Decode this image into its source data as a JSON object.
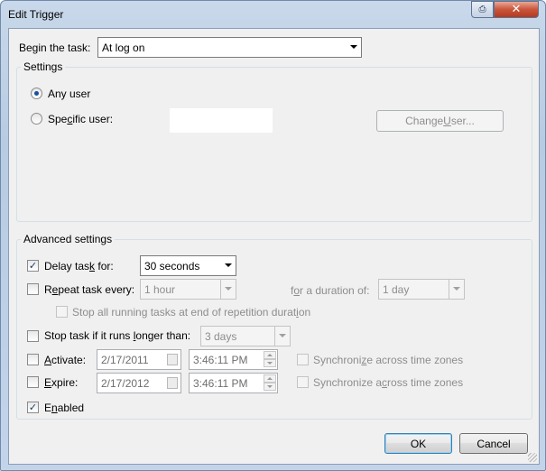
{
  "window": {
    "title": "Edit Trigger",
    "help_icon": "help-icon",
    "close_glyph": "✕"
  },
  "begin_task": {
    "label_prefix": "Begin the task:",
    "value": "At log on"
  },
  "settings": {
    "title": "Settings",
    "any_user": "Any user",
    "specific_user_pre": "Spe",
    "specific_user_u": "c",
    "specific_user_post": "ific user:",
    "change_user_pre": "Change ",
    "change_user_u": "U",
    "change_user_post": "ser..."
  },
  "advanced": {
    "title": "Advanced settings",
    "delay": {
      "checked": true,
      "label_pre": "Delay tas",
      "label_u": "k",
      "label_post": " for:",
      "value": "30 seconds"
    },
    "repeat": {
      "checked": false,
      "label_pre": "R",
      "label_u": "e",
      "label_post": "peat task every:",
      "value": "1 hour",
      "duration_pre": "f",
      "duration_u": "o",
      "duration_post": "r a duration of:",
      "duration_value": "1 day"
    },
    "stop_all": {
      "checked": false,
      "label_pre": "Stop all running tasks at end of repetition durat",
      "label_u": "i",
      "label_post": "on"
    },
    "stop_longer": {
      "checked": false,
      "label_pre": "Stop task if it runs ",
      "label_u": "l",
      "label_post": "onger than:",
      "value": "3 days"
    },
    "activate": {
      "checked": false,
      "label_u": "A",
      "label_post": "ctivate:",
      "date": "2/17/2011",
      "time": "3:46:11 PM",
      "sync_pre": "Synchroni",
      "sync_u": "z",
      "sync_post": "e across time zones"
    },
    "expire": {
      "checked": false,
      "label_u": "E",
      "label_post": "xpire:",
      "date": "2/17/2012",
      "time": "3:46:11 PM",
      "sync_pre": "Synchronize a",
      "sync_u": "c",
      "sync_post": "ross time zones"
    },
    "enabled": {
      "checked": true,
      "label_pre": "E",
      "label_u": "n",
      "label_post": "abled"
    }
  },
  "buttons": {
    "ok": "OK",
    "cancel": "Cancel"
  },
  "checkmark": "✓"
}
